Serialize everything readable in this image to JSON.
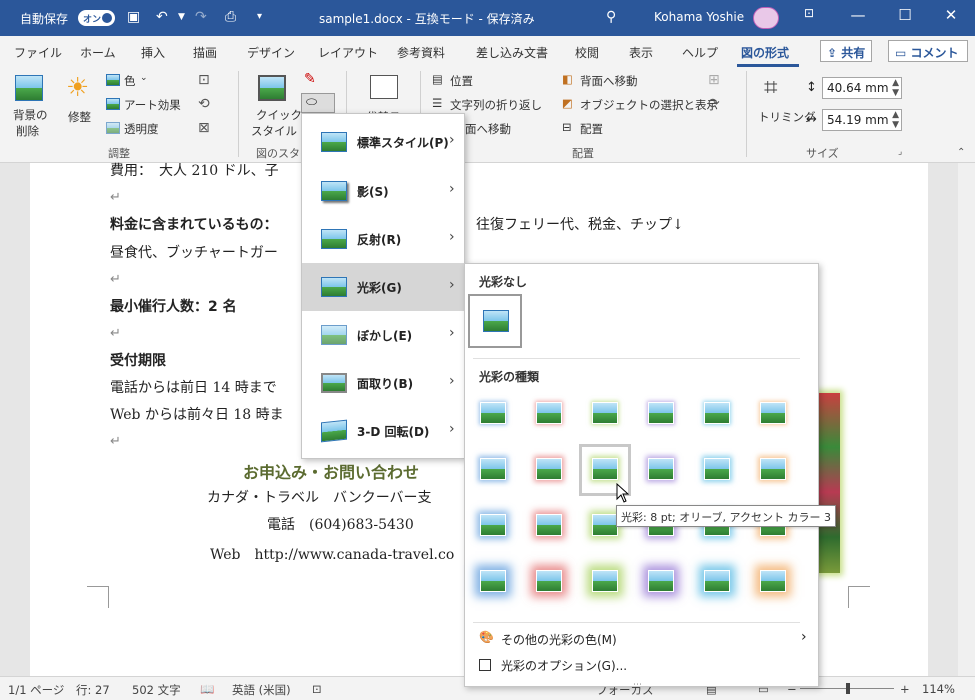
{
  "titlebar": {
    "autosave": "自動保存",
    "toggle": "オン",
    "doc_title": "sample1.docx  -  互換モード - 保存済み",
    "user": "Kohama Yoshie",
    "min": "—",
    "max": "☐",
    "close": "✕"
  },
  "tabs": [
    "ファイル",
    "ホーム",
    "挿入",
    "描画",
    "デザイン",
    "レイアウト",
    "参考資料",
    "差し込み文書",
    "校閲",
    "表示",
    "ヘルプ",
    "図の形式"
  ],
  "share": "共有",
  "comment": "コメント",
  "ribbon": {
    "remove_bg": [
      "背景の",
      "削除"
    ],
    "corrections": "修整",
    "color": "色",
    "art_effects": "アート効果",
    "transparency": "透明度",
    "adjust_group": "調整",
    "quick_style": [
      "クイック",
      "スタイル"
    ],
    "style_group": "図のスタイル",
    "alt_text": "代替テ",
    "position": "位置",
    "wrap_text": "文字列の折り返し",
    "bring_front": "面へ移動",
    "send_back": "背面へ移動",
    "selection_pane": "オブジェクトの選択と表示",
    "align": "配置",
    "arrange_group": "配置",
    "crop": "トリミング",
    "height": "40.64 mm",
    "width": "54.19 mm",
    "size_group": "サイズ"
  },
  "document": {
    "line1": "費用：　大人 210 ドル、子",
    "line2_label": "料金に含まれているもの：",
    "line2_value": "往復フェリー代、税金、チップ↓",
    "line3": "昼食代、ブッチャートガー",
    "line4": "最小催行人数：2 名",
    "line5": "受付期限",
    "line6": "電話からは前日 14 時まで",
    "line7": "Web からは前々日 18 時ま",
    "headline": "お申込み・お問い合わせ",
    "addr1": "カナダ・トラベル　バンクーバー支",
    "addr2": "電話　(604)683-5430",
    "addr3": "Web　http://www.canada-travel.co",
    "para_mark": "↵"
  },
  "menu": [
    {
      "label": "標準スタイル(P)"
    },
    {
      "label": "影(S)"
    },
    {
      "label": "反射(R)"
    },
    {
      "label": "光彩(G)"
    },
    {
      "label": "ぼかし(E)"
    },
    {
      "label": "面取り(B)"
    },
    {
      "label": "3-D 回転(D)"
    }
  ],
  "submenu": {
    "no_glow": "光彩なし",
    "variations": "光彩の種類",
    "glow_colors": [
      "#4a90d9",
      "#e06060",
      "#9ccc4a",
      "#8a6ad0",
      "#40b0e0",
      "#f0a050"
    ],
    "more_colors": "その他の光彩の色(M)",
    "options": "光彩のオプション(G)...",
    "tooltip": "光彩: 8 pt; オリーブ, アクセント カラー 3"
  },
  "status": {
    "page": "1/1 ページ",
    "line": "行: 27",
    "chars": "502 文字",
    "lang": "英語 (米国)",
    "focus": "フォーカス",
    "zoom": "114%"
  }
}
